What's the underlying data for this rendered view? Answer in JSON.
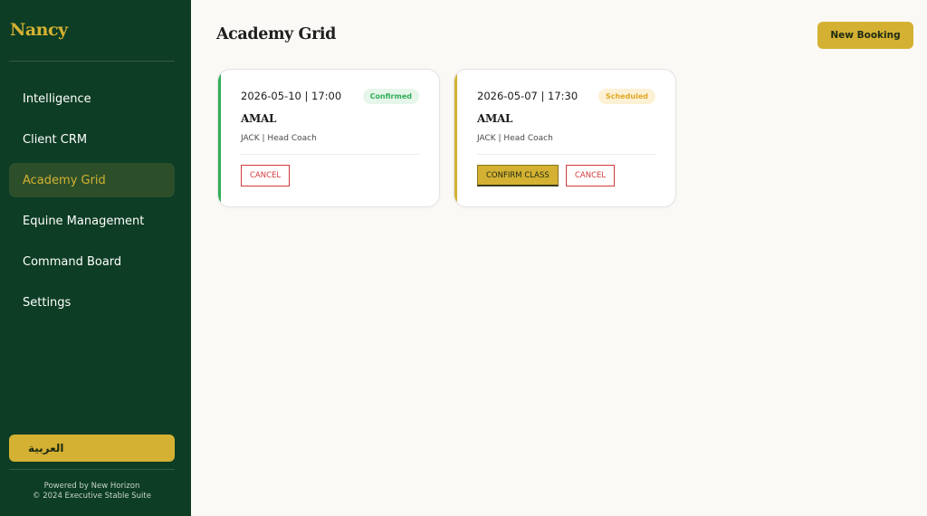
{
  "app": {
    "brand": "Nancy"
  },
  "sidebar": {
    "items": [
      {
        "label": "Intelligence",
        "active": false
      },
      {
        "label": "Client CRM",
        "active": false
      },
      {
        "label": "Academy Grid",
        "active": true
      },
      {
        "label": "Equine Management",
        "active": false
      },
      {
        "label": "Command Board",
        "active": false
      },
      {
        "label": "Settings",
        "active": false
      }
    ],
    "language_button": "العربية",
    "footer": {
      "line1": "Powered by New Horizon",
      "line2": "© 2024 Executive Stable Suite"
    }
  },
  "main": {
    "title": "Academy Grid",
    "new_booking_label": "New Booking",
    "bookings": [
      {
        "datetime": "2026-05-10 | 17:00",
        "status": "Confirmed",
        "student": "AMAL",
        "coach": "JACK | Head Coach",
        "cancel_label": "CANCEL"
      },
      {
        "datetime": "2026-05-07 | 17:30",
        "status": "Scheduled",
        "student": "AMAL",
        "coach": "JACK | Head Coach",
        "confirm_label": "CONFIRM CLASS",
        "cancel_label": "CANCEL"
      }
    ]
  },
  "colors": {
    "sidebar_bg": "#0d3d24",
    "accent_gold": "#d4b132",
    "confirmed_green": "#2fae57",
    "scheduled_amber": "#e0a826",
    "cancel_red": "#d33a3a"
  }
}
